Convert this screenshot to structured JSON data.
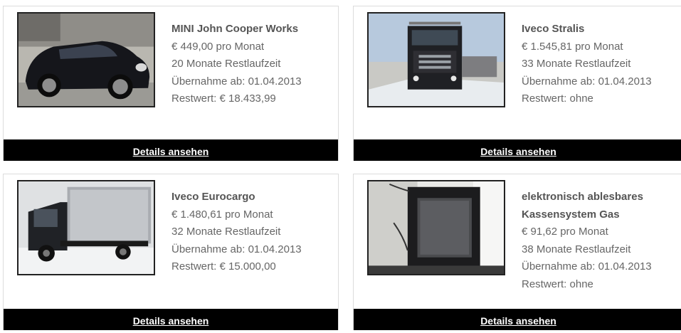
{
  "listings": [
    {
      "title": "MINI John Cooper Works",
      "monthly": "€ 449,00 pro Monat",
      "remaining": "20 Monate Restlaufzeit",
      "takeover": "Übernahme ab: 01.04.2013",
      "residual": "Restwert: € 18.433,99",
      "button": "Details ansehen",
      "image_icon": "car-photo"
    },
    {
      "title": "Iveco Stralis",
      "monthly": "€ 1.545,81 pro Monat",
      "remaining": "33 Monate Restlaufzeit",
      "takeover": "Übernahme ab: 01.04.2013",
      "residual": "Restwert: ohne",
      "button": "Details ansehen",
      "image_icon": "truck-photo"
    },
    {
      "title": "Iveco Eurocargo",
      "monthly": "€ 1.480,61 pro Monat",
      "remaining": "32 Monate Restlaufzeit",
      "takeover": "Übernahme ab: 01.04.2013",
      "residual": "Restwert: € 15.000,00",
      "button": "Details ansehen",
      "image_icon": "box-truck-photo"
    },
    {
      "title": "elektronisch ablesbares Kassensystem Gas",
      "monthly": "€ 91,62 pro Monat",
      "remaining": "38 Monate Restlaufzeit",
      "takeover": "Übernahme ab: 01.04.2013",
      "residual": "Restwert: ohne",
      "button": "Details ansehen",
      "image_icon": "device-photo"
    }
  ]
}
